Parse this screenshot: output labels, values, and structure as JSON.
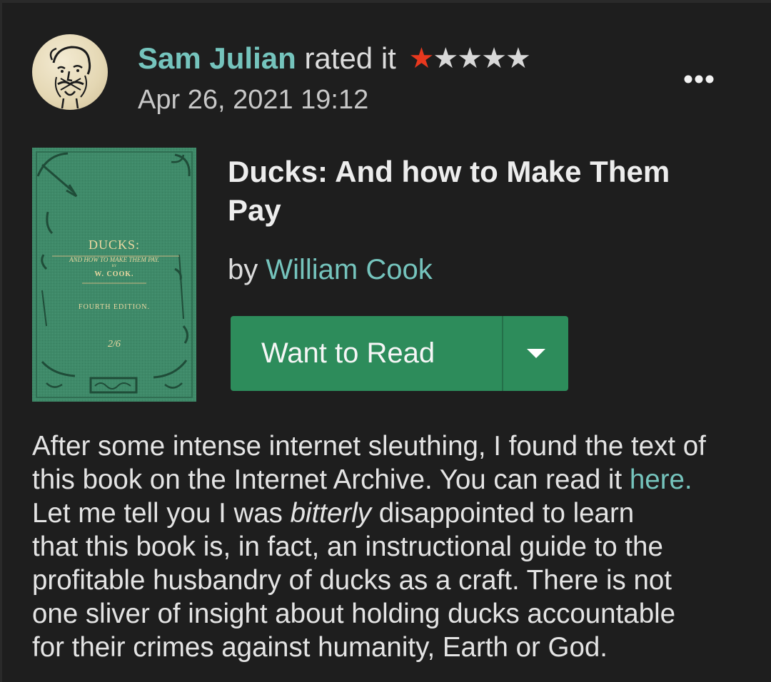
{
  "review": {
    "user_name": "Sam Julian",
    "rated_text": "rated it",
    "rating": 1,
    "rating_max": 5,
    "timestamp": "Apr 26, 2021 19:12",
    "more_icon": "more-horizontal-icon",
    "avatar_icon": "user-avatar-sketch"
  },
  "book": {
    "title": "Ducks: And how to Make Them Pay",
    "by_label": "by",
    "author": "William Cook",
    "cover": {
      "title": "DUCKS:",
      "subtitle": "AND HOW TO MAKE THEM PAY.",
      "by": "BY",
      "author": "W. COOK.",
      "edition": "FOURTH EDITION.",
      "price": "2/6"
    }
  },
  "shelf_button": {
    "label": "Want to Read",
    "dropdown_icon": "caret-down-icon"
  },
  "body": {
    "line1": "After some intense internet sleuthing, I found the text of",
    "line2_before": "this book on the Internet Archive. You can read it ",
    "line2_link": "here.",
    "line3_before": "Let me tell you I was ",
    "line3_em": "bitterly",
    "line3_after": " disappointed to learn",
    "line4": "that this book is, in fact, an instructional guide to the",
    "line5": "profitable husbandry of ducks as a craft. There is not",
    "line6": "one sliver of insight about holding ducks accountable",
    "line7": "for their crimes against humanity, Earth or God."
  },
  "colors": {
    "background": "#1e1e1e",
    "link": "#75c4bd",
    "star_filled": "#e8381e",
    "star_empty": "#d8d8d8",
    "button": "#2d8c5b",
    "cover": "#3f8a69"
  }
}
